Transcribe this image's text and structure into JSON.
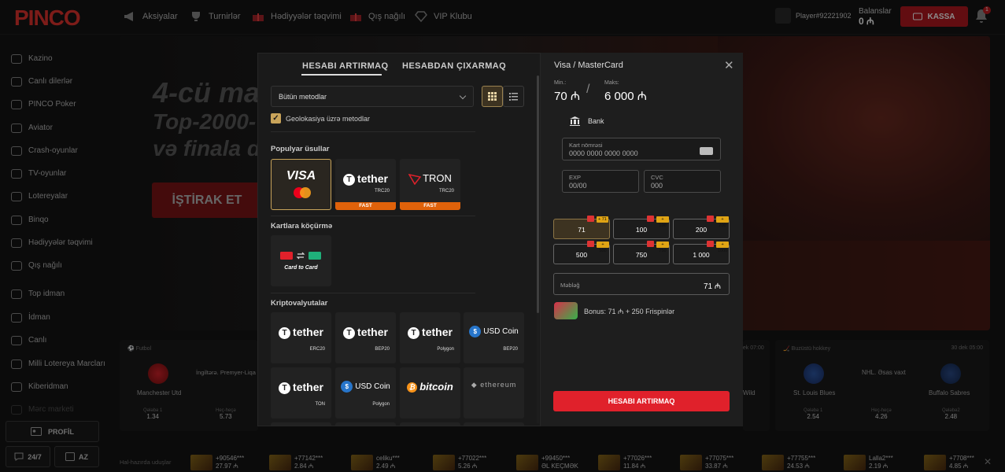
{
  "header": {
    "logo": "PINCO",
    "nav": [
      {
        "label": "Aksiyalar",
        "icon": "megaphone-icon"
      },
      {
        "label": "Turnirlər",
        "icon": "trophy-icon"
      },
      {
        "label": "Hədiyyələr təqvimi",
        "icon": "gift-icon"
      },
      {
        "label": "Qış nağılı",
        "icon": "gift-icon"
      },
      {
        "label": "VIP Klubu",
        "icon": "diamond-icon"
      }
    ],
    "player": "Player#92221902",
    "balance_label": "Balanslar",
    "balance_value": "0 ₼",
    "cashier": "KASSA",
    "notifications": "1"
  },
  "sidebar": {
    "items": [
      {
        "label": "Kazino",
        "icon": "casino-chip-icon"
      },
      {
        "label": "Canlı dilerlər",
        "icon": "dealer-icon"
      },
      {
        "label": "PINCO Poker",
        "icon": "poker-icon"
      },
      {
        "label": "Aviator",
        "icon": "plane-icon"
      },
      {
        "label": "Crash-oyunlar",
        "icon": "rocket-icon"
      },
      {
        "label": "TV-oyunlar",
        "icon": "tv-icon"
      },
      {
        "label": "Lotereyalar",
        "icon": "lottery-icon"
      },
      {
        "label": "Binqo",
        "icon": "bingo-icon"
      },
      {
        "label": "Hədiyyələr təqvimi",
        "icon": "gift-icon"
      },
      {
        "label": "Qış nağılı",
        "icon": "gift-icon"
      },
      {
        "label": "Top idman",
        "icon": "running-icon"
      },
      {
        "label": "İdman",
        "icon": "ball-icon"
      },
      {
        "label": "Canlı",
        "icon": "live-icon"
      },
      {
        "label": "Milli Lotereya Marcları",
        "icon": "globe-icon"
      },
      {
        "label": "Kiberidman",
        "icon": "gamepad-icon"
      },
      {
        "label": "Mərc marketi",
        "icon": "market-icon"
      }
    ],
    "profile": "PROFİL",
    "support": "24/7",
    "lang": "AZ"
  },
  "hero": {
    "line1": "4-cü ma",
    "line2": "Top-2000-",
    "line3": "və finala d",
    "button": "İŞTİRAK ET"
  },
  "matches": [
    {
      "sport": "Futbol",
      "team1": "Manchester Utd",
      "league": "İngiltərə. Premyer-Liqa",
      "o1_label": "Qələbə 1",
      "o1": "1.34",
      "ox_label": "Heç-heçə",
      "ox": "5.73"
    },
    {
      "time": "dek 07:00",
      "team2": "Wild"
    },
    {
      "sport": "Buzüstü hokkey",
      "time": "30 dek 05:00",
      "team1": "St. Louis Blues",
      "league": "NHL. Əsas vaxt",
      "team2": "Buffalo Sabres",
      "o1_label": "Qələbə 1",
      "o1": "2.54",
      "ox_label": "Heç-heçə",
      "ox": "4.26",
      "o2_label": "Qələbə2",
      "o2": "2.48"
    }
  ],
  "ticker": {
    "label": "Hal-hazırda uduşlar",
    "wins": [
      {
        "user": "+90546***",
        "amount": "27.97 ₼"
      },
      {
        "user": "+77142***",
        "amount": "2.84 ₼"
      },
      {
        "user": "celiku***",
        "amount": "2.49 ₼"
      },
      {
        "user": "+77022***",
        "amount": "5.26 ₼"
      },
      {
        "user": "+99450***",
        "amount": "ƏL KEÇMƏK"
      },
      {
        "user": "+77026***",
        "amount": "11.84 ₼"
      },
      {
        "user": "+77075***",
        "amount": "33.87 ₼"
      },
      {
        "user": "+77755***",
        "amount": "24.53 ₼"
      },
      {
        "user": "Lalla2***",
        "amount": "2.19 ₼"
      },
      {
        "user": "+7708***",
        "amount": "4.85 ₼"
      }
    ]
  },
  "modal": {
    "tabs": [
      "HESABI ARTIRMAQ",
      "HESABDAN ÇIXARMAQ"
    ],
    "filter": "Bütün metodlar",
    "geo_label": "Geolokasiya üzrə metodlar",
    "sections": {
      "popular": "Populyar üsullar",
      "cards": "Kartlara köçürmə",
      "crypto": "Kriptovalyutalar"
    },
    "popular": [
      {
        "name": "VISA",
        "sub": ""
      },
      {
        "name": "tether",
        "sub": "TRC20",
        "badge": "FAST"
      },
      {
        "name": "TRON",
        "sub": "TRC20",
        "badge": "FAST"
      }
    ],
    "card_to_card": "Card to Card",
    "crypto": [
      {
        "name": "tether",
        "sub": "ERC20"
      },
      {
        "name": "tether",
        "sub": "BEP20"
      },
      {
        "name": "tether",
        "sub": "Polygon"
      },
      {
        "name": "USD Coin",
        "sub": "BEP20"
      },
      {
        "name": "tether",
        "sub": "TON"
      },
      {
        "name": "USD Coin",
        "sub": "Polygon"
      },
      {
        "name": "bitcoin",
        "sub": ""
      },
      {
        "name": "ethereum",
        "sub": ""
      }
    ]
  },
  "deposit": {
    "title": "Visa / MasterCard",
    "min_label": "Min.:",
    "min": "70 ₼",
    "max_label": "Maks:",
    "max": "6 000 ₼",
    "bank": "Bank",
    "card_label": "Kart nömrəsi",
    "card_placeholder": "0000 0000 0000 0000",
    "exp_label": "EXP",
    "exp_placeholder": "00/00",
    "cvc_label": "CVC",
    "cvc_placeholder": "000",
    "amounts": [
      {
        "value": "71",
        "bonus": "+ 71"
      },
      {
        "value": "100",
        "bonus": "+ 100"
      },
      {
        "value": "200",
        "bonus": "+ 200"
      },
      {
        "value": "500",
        "bonus": "+ 500"
      },
      {
        "value": "750",
        "bonus": "+ 750"
      },
      {
        "value": "1 000",
        "bonus": "+ 1000"
      }
    ],
    "amount_label": "Məbləğ",
    "amount_value": "71 ₼",
    "bonus_text": "Bonus: 71 ₼ + 250 Frispinlər",
    "submit": "HESABI ARTIRMAQ"
  },
  "colors": {
    "accent": "#e0212b",
    "gold": "#c9a45a",
    "fast": "#e0620a"
  }
}
